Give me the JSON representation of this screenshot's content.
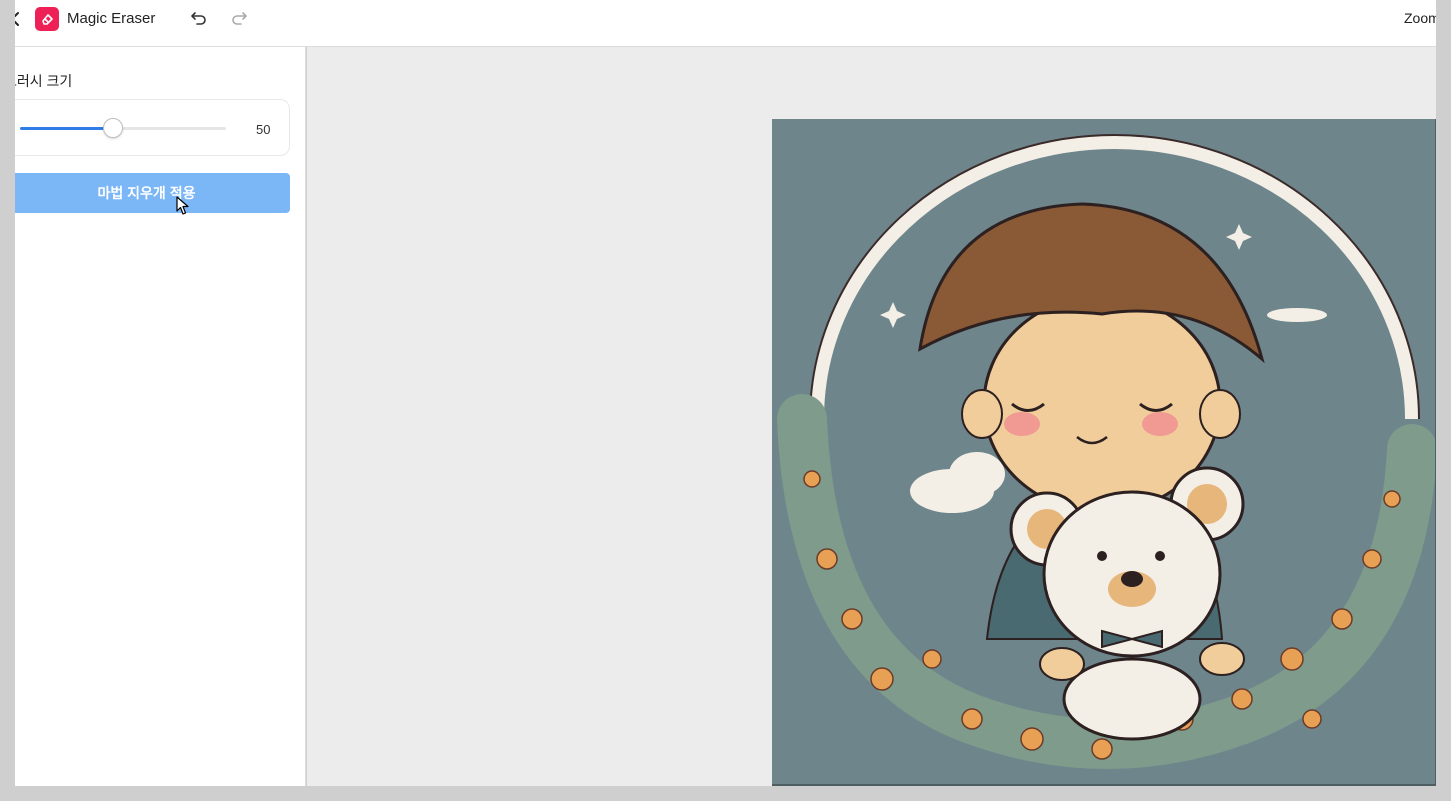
{
  "header": {
    "app_title": "Magic Eraser",
    "zoom_label": "Zoom",
    "icons": {
      "back": "chevron-left-icon",
      "logo": "eraser-logo-icon",
      "undo": "undo-icon",
      "redo": "redo-icon"
    }
  },
  "sidebar": {
    "brush_size_label": "브러시 크기",
    "brush_size_value": "50",
    "brush_size_fraction": 0.45,
    "apply_button_label": "마법 지우개 적용"
  },
  "canvas": {
    "image_description_icon": "illustration-image"
  },
  "colors": {
    "accent": "#2f7ce8",
    "button": "#7bb6f7",
    "logo": "#ee2156",
    "canvas_bg": "#ececec",
    "image_bg": "#6e858b"
  }
}
